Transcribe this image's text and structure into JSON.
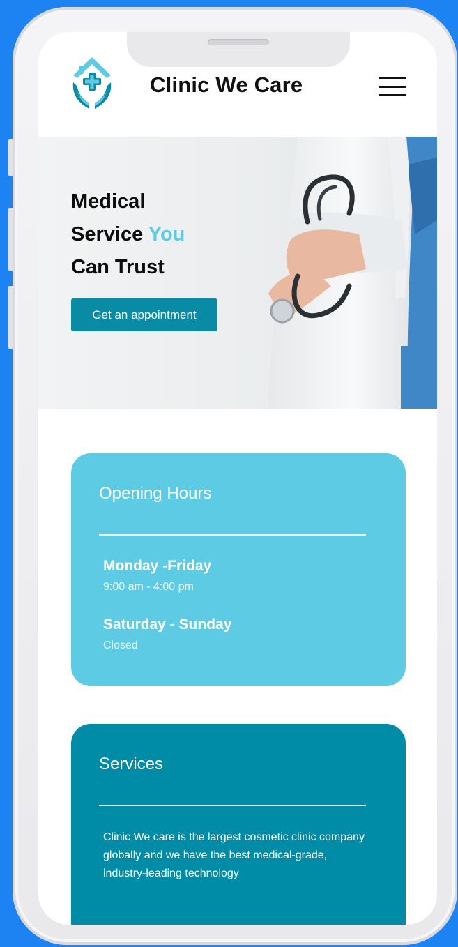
{
  "brand": {
    "name": "Clinic We Care",
    "logo_icon": "house-cross-hands-icon",
    "colors": {
      "teal": "#0a8ba5",
      "light_teal": "#5ecbe4",
      "dark_teal": "#008ba7",
      "background": "#1d82f2"
    }
  },
  "nav": {
    "menu_icon": "hamburger-menu-icon"
  },
  "hero": {
    "title_line1": "Medical",
    "title_line2_prefix": "Service",
    "title_line2_accent": "You",
    "title_line3": "Can Trust",
    "cta_label": "Get an appointment",
    "image_subject": "doctor with stethoscope"
  },
  "opening_hours": {
    "title": "Opening Hours",
    "schedule": [
      {
        "days": "Monday -Friday",
        "hours": "9:00 am - 4:00  pm"
      },
      {
        "days": "Saturday - Sunday",
        "hours": "Closed"
      }
    ]
  },
  "services": {
    "title": "Services",
    "description": "Clinic We care is the largest cosmetic clinic company globally and we have the best medical-grade, industry-leading technology"
  }
}
